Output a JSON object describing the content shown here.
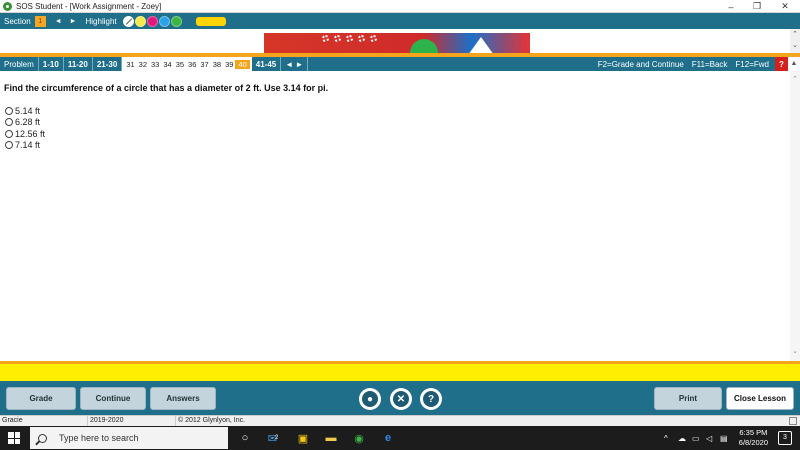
{
  "window": {
    "title": "SOS Student - [Work Assignment - Zoey]",
    "controls": {
      "minimize": "–",
      "restore": "❐",
      "close": "✕"
    }
  },
  "section_bar": {
    "section_label": "Section",
    "section_number": "1",
    "arrows": "◄ ►",
    "highlight_label": "Highlight",
    "swatches": [
      "#ffffff",
      "#f7e94a",
      "#e3187c",
      "#2aa3e6",
      "#3cb543"
    ],
    "highlighter_color": "#ffd400"
  },
  "outer_scroll": {
    "up": "⌃",
    "down": "⌄"
  },
  "problem_bar": {
    "label": "Problem",
    "ranges": [
      "1-10",
      "11-20",
      "21-30"
    ],
    "numbers": [
      "31",
      "32",
      "33",
      "34",
      "35",
      "36",
      "37",
      "38",
      "39",
      "40"
    ],
    "current": "40",
    "next_range": "41-45",
    "arrows": "◄ ►",
    "key_hints": [
      "F2=Grade and Continue",
      "F11=Back",
      "F12=Fwd"
    ],
    "help": "?"
  },
  "question": {
    "text": "Find the circumference of a circle that has a diameter of 2 ft. Use 3.14 for pi.",
    "options": [
      "5.14 ft",
      "6.28 ft",
      "12.56 ft",
      "7.14 ft"
    ]
  },
  "buttons": {
    "grade": "Grade",
    "continue": "Continue",
    "answers": "Answers",
    "print": "Print",
    "close_lesson": "Close Lesson",
    "tool_icons": [
      "speech-bubble-icon",
      "tools-icon",
      "help-icon"
    ]
  },
  "status": {
    "user": "Gracie",
    "year": "2019-2020",
    "copyright": "© 2012 Glynlyon, Inc."
  },
  "taskbar": {
    "search_placeholder": "Type here to search",
    "mail_badge": "2",
    "time": "6:35 PM",
    "date": "6/8/2020",
    "notifications": "3"
  },
  "colors": {
    "teal": "#1f6f8b",
    "orange": "#f4a51b",
    "yellow": "#ffee00",
    "help_red": "#d41f1f"
  }
}
